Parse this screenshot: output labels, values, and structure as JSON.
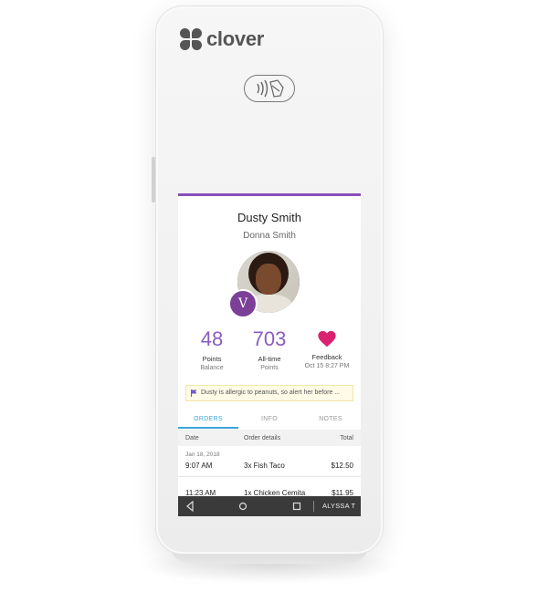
{
  "device": {
    "brand": "clover"
  },
  "customer": {
    "name": "Dusty Smith",
    "employee": "Donna Smith",
    "avatar_initial": "V"
  },
  "stats": [
    {
      "value": "48",
      "label": "Points",
      "sub": "Balance"
    },
    {
      "value": "703",
      "label": "All-time",
      "sub": "Points"
    },
    {
      "icon": "heart-icon",
      "label": "Feedback",
      "sub": "Oct 15 8:27 PM"
    }
  ],
  "alert": {
    "icon": "flag-icon",
    "text": "Dusty is allergic to peanuts, so alert her before ..."
  },
  "tabs": [
    {
      "label": "ORDERS",
      "active": true
    },
    {
      "label": "INFO",
      "active": false
    },
    {
      "label": "NOTES",
      "active": false
    }
  ],
  "orders": {
    "headers": {
      "date": "Date",
      "details": "Order details",
      "total": "Total"
    },
    "rows": [
      {
        "date": "Jan 18, 2018",
        "time": "9:07 AM",
        "details": "3x Fish Taco",
        "total": "$12.50"
      },
      {
        "date": "",
        "time": "11:23 AM",
        "details": "1x Chicken Cemita",
        "total": "$11.95"
      }
    ]
  },
  "navbar": {
    "back_icon": "back-triangle-icon",
    "home_icon": "home-circle-icon",
    "recents_icon": "recents-square-icon",
    "user": "ALYSSA T"
  },
  "colors": {
    "accent_purple": "#8a5cc0",
    "tab_blue": "#3da5d9",
    "heart": "#d9216f",
    "badge": "#7b3f98"
  }
}
